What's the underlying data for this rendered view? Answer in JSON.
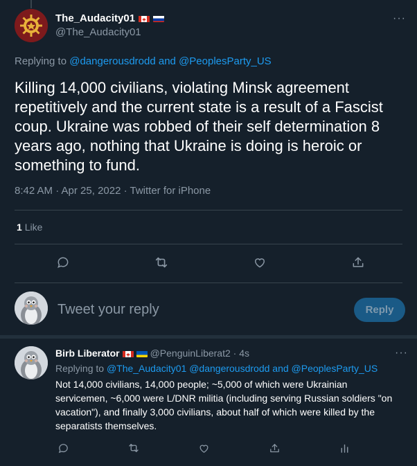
{
  "main_tweet": {
    "display_name": "The_Audacity01",
    "handle": "@The_Audacity01",
    "flags": [
      "canada-flag",
      "russia-flag"
    ],
    "replying_prefix": "Replying to",
    "replying_to": "@dangerousdrodd and @PeoplesParty_US",
    "text": "Killing 14,000 civilians, violating Minsk agreement repetitively and the current state is a result of a Fascist coup. Ukraine was robbed of their self determination 8 years ago, nothing that Ukraine is doing is heroic or something to fund.",
    "meta": "8:42 AM · Apr 25, 2022 · Twitter for iPhone",
    "like_count": "1",
    "like_label": "Like",
    "more": "···",
    "actions": [
      "reply-icon",
      "retweet-icon",
      "like-icon",
      "share-icon"
    ]
  },
  "reply_box": {
    "placeholder": "Tweet your reply",
    "button_label": "Reply"
  },
  "reply_tweet": {
    "display_name": "Birb Liberator",
    "flags": [
      "canada-flag",
      "ukraine-flag"
    ],
    "handle_time": "@PenguinLiberat2 · 4s",
    "replying_prefix": "Replying to",
    "replying_to": "@The_Audacity01 @dangerousdrodd and @PeoplesParty_US",
    "text": "Not 14,000 civilians, 14,000 people; ~5,000 of which were Ukrainian servicemen, ~6,000 were L/DNR militia (including serving Russian soldiers \"on vacation\"), and finally 3,000 civilians, about half of which were killed by the separatists themselves.",
    "more": "···",
    "actions": [
      "reply-icon",
      "retweet-icon",
      "like-icon",
      "share-icon",
      "analytics-icon"
    ]
  },
  "colors": {
    "background": "#15202b",
    "link": "#1d9bf0",
    "muted": "#8b98a5",
    "divider": "#38444d"
  }
}
